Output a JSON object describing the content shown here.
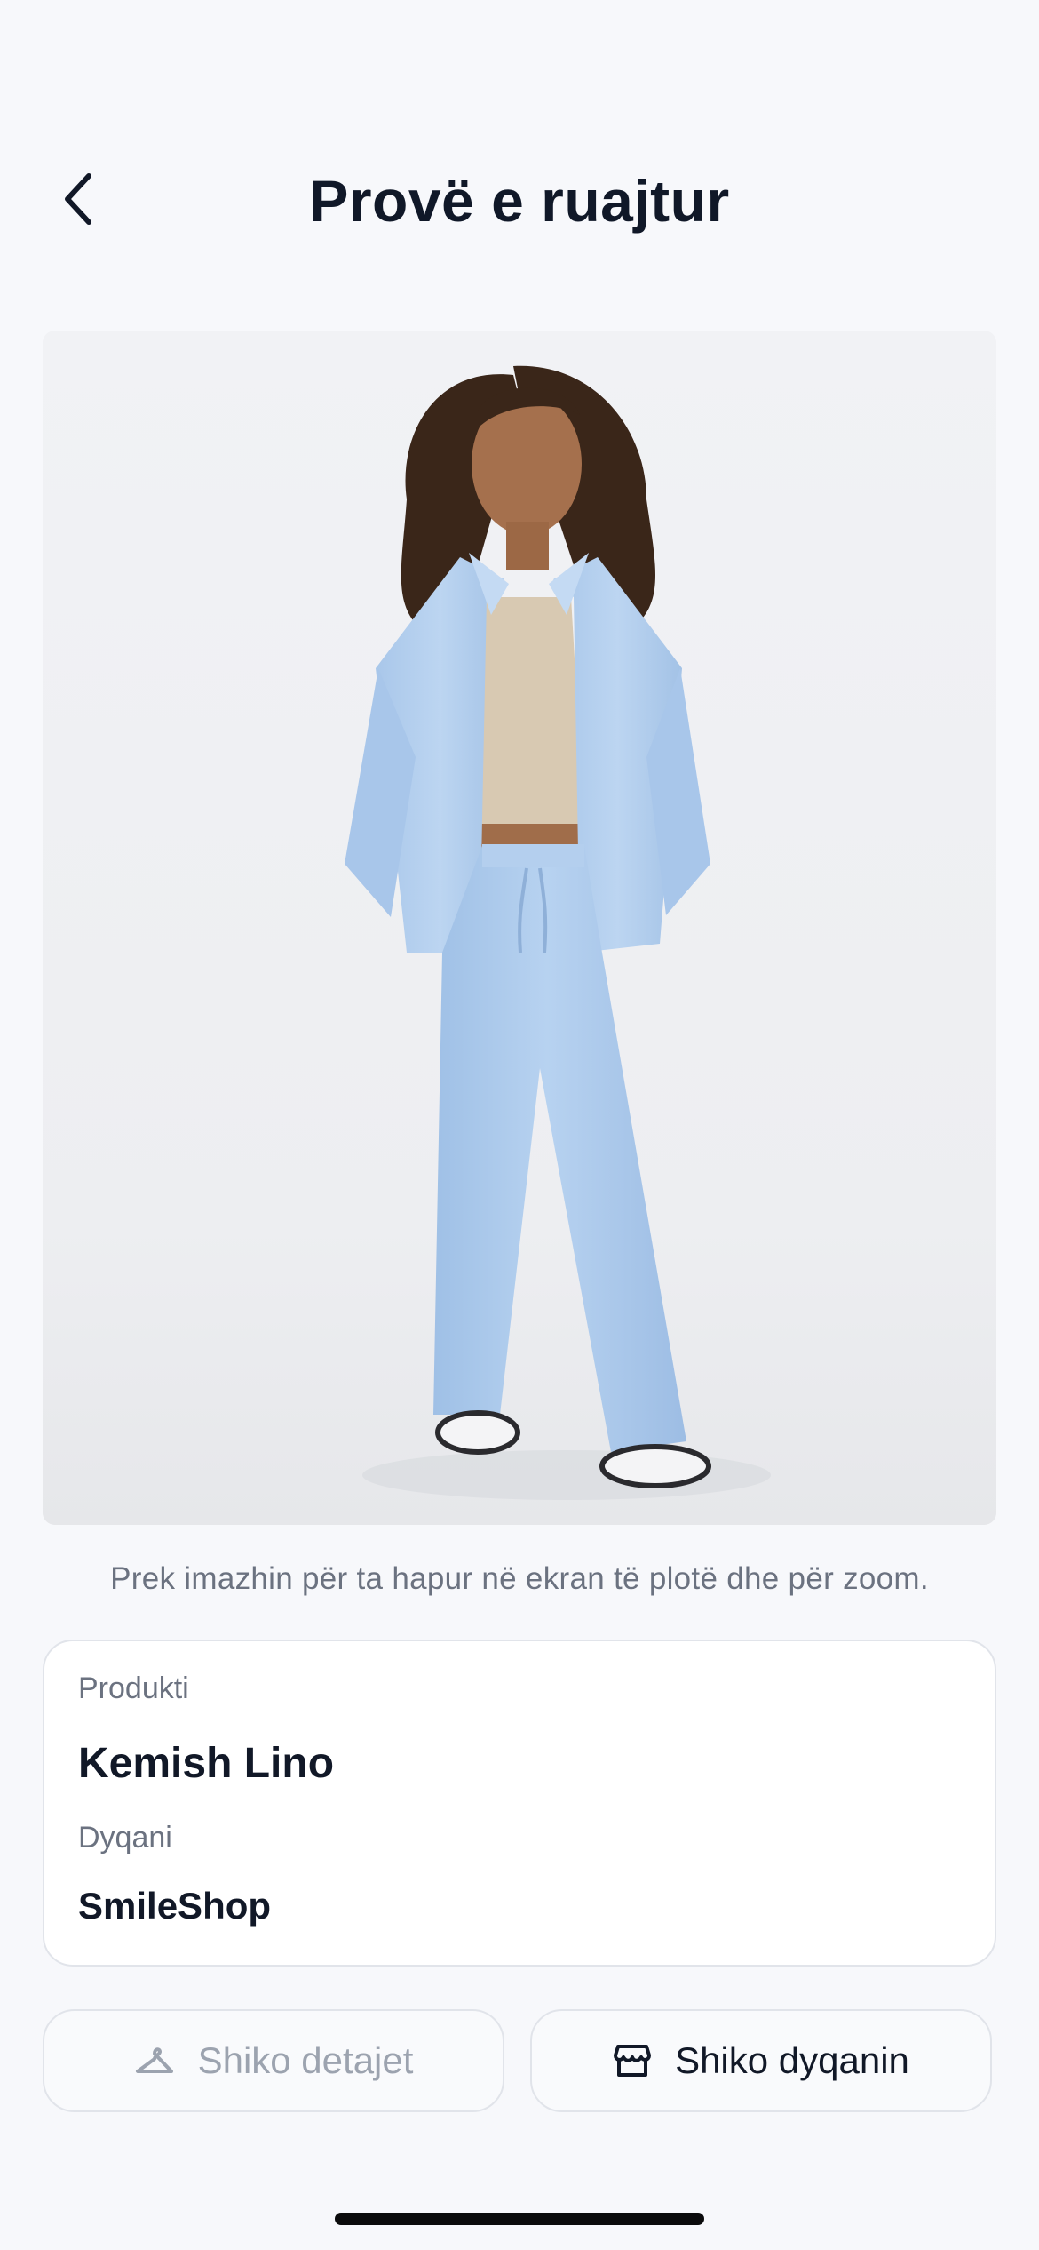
{
  "header": {
    "title": "Provë e ruajtur",
    "back_icon": "chevron-left-icon"
  },
  "image": {
    "alt": "Kemish Lino",
    "hint": "Prek imazhin për ta hapur në ekran të plotë dhe për zoom."
  },
  "product_card": {
    "product_label": "Produkti",
    "product_name": "Kemish Lino",
    "shop_label": "Dyqani",
    "shop_name": "SmileShop"
  },
  "actions": {
    "details_label": "Shiko detajet",
    "details_icon": "hanger-icon",
    "details_enabled": false,
    "shop_label": "Shiko dyqanin",
    "shop_icon": "storefront-icon"
  },
  "colors": {
    "background": "#f7f8fb",
    "text_primary": "#111827",
    "text_secondary": "#6b7280",
    "disabled_text": "#9ca3af",
    "border": "#e1e4ea"
  }
}
